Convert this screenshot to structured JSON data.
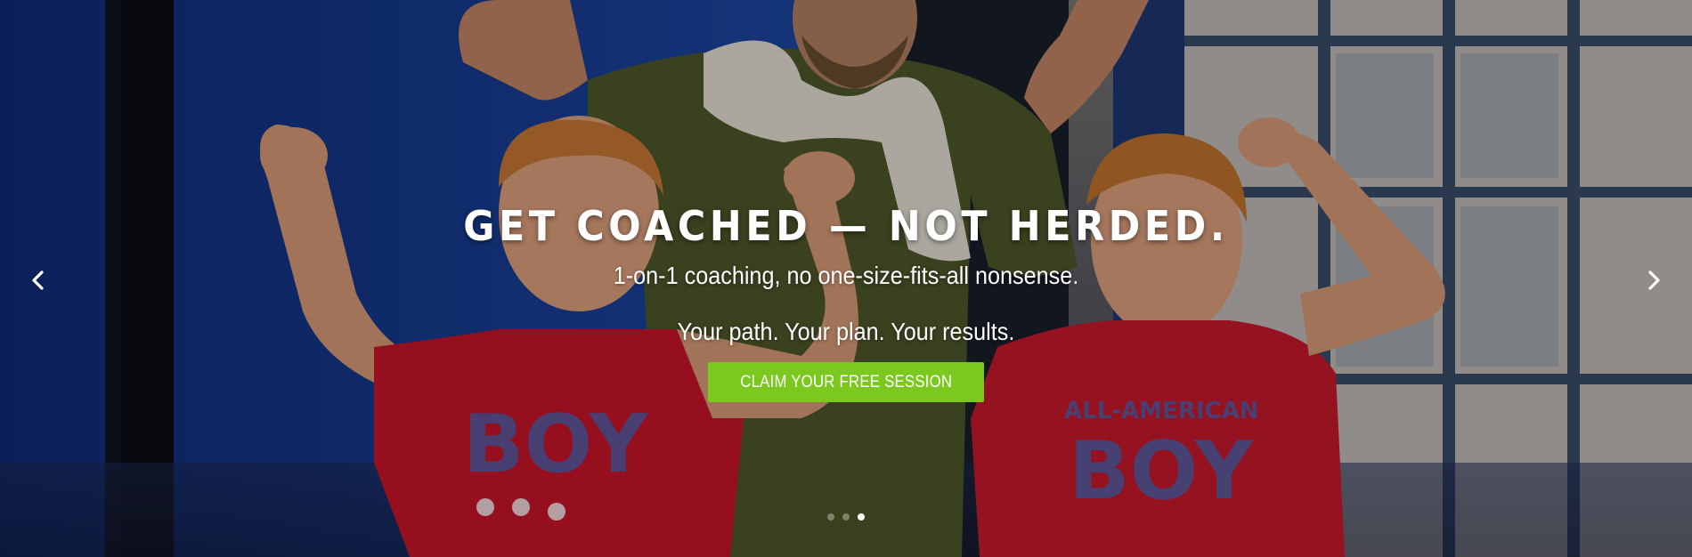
{
  "slider": {
    "headline": "GET COACHED — NOT HERDED.",
    "subline": "1-on-1 coaching, no one-size-fits-all nonsense.",
    "tagline": "Your path. Your plan. Your results.",
    "cta_label": "CLAIM YOUR FREE SESSION",
    "prev_icon": "chevron-left-icon",
    "next_icon": "chevron-right-icon",
    "slide_count": 3,
    "active_slide": 3
  },
  "colors": {
    "cta_background": "#7bc91f",
    "text": "#ffffff"
  }
}
